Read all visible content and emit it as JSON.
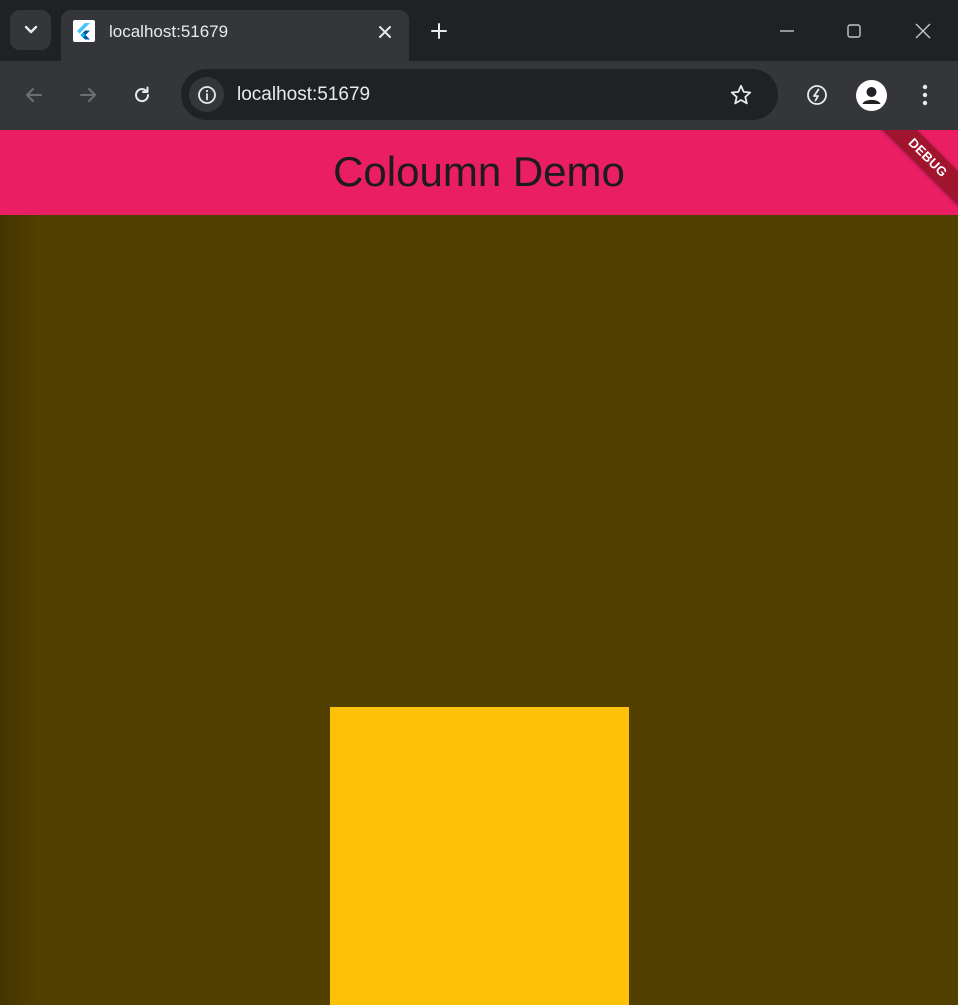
{
  "browser": {
    "tab": {
      "title": "localhost:51679",
      "favicon": "flutter-icon",
      "close_icon": "close-icon"
    },
    "new_tab_icon": "plus-icon",
    "tab_search_icon": "chevron-down-icon",
    "window_controls": [
      "minimize-icon",
      "maximize-icon",
      "close-icon"
    ],
    "toolbar": {
      "back_icon": "arrow-left-icon",
      "forward_icon": "arrow-right-icon",
      "reload_icon": "reload-icon",
      "site_info_icon": "info-icon",
      "url": "localhost:51679",
      "bookmark_icon": "star-icon",
      "extension_icon": "leaf-icon",
      "profile_icon": "person-icon",
      "menu_icon": "kebab-menu-icon"
    }
  },
  "app": {
    "title": "Coloumn Demo",
    "debug_banner": "DEBUG",
    "colors": {
      "appbar": "#e91e63",
      "background": "#524000",
      "box": "#ffc107"
    }
  }
}
